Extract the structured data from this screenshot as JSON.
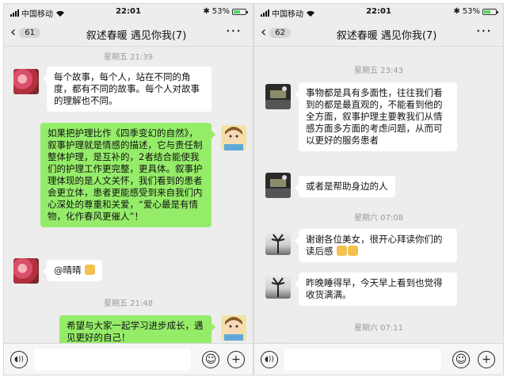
{
  "status": {
    "carrier": "中国移动",
    "time": "22:01",
    "battery": "53%",
    "battery_level": 0.53
  },
  "left": {
    "back_count": "61",
    "title": "叙述春暖 遇见你我(7)",
    "more": "···",
    "messages": [
      {
        "type": "time",
        "text": "星期五 21:39"
      },
      {
        "type": "in",
        "text": "每个故事，每个人，站在不同的角度，都有不同的故事。每个人对故事的理解也不同。"
      },
      {
        "type": "out",
        "text": "如果把护理比作《四季变幻的自然》，叙事护理就是情感的描述，它与责任制整体护理，是互补的，2者结合能使我们的护理工作更完整，更具体。叙事护理体现的是人文关怀，我们看到的患者会更立体，患者更能感受到来自我们内心深处的尊重和关爱，“爱心最是有情物，化作春风更催人”！"
      },
      {
        "type": "in",
        "text": "@晴晴"
      },
      {
        "type": "time",
        "text": "星期五 21:48"
      },
      {
        "type": "out",
        "text": "希望与大家一起学习进步成长，遇见更好的自己！"
      }
    ]
  },
  "right": {
    "back_count": "62",
    "title": "叙述春暖 遇见你我(7)",
    "more": "···",
    "messages": [
      {
        "type": "time",
        "text": "星期五 23:43"
      },
      {
        "type": "in",
        "text": "事物都是具有多面性，往往我们看到的都是最直观的，不能看到他的全方面，叙事护理主要教我们从情感方面多方面的考虑问题，从而可以更好的服务患者"
      },
      {
        "type": "in",
        "text": "或者是帮助身边的人"
      },
      {
        "type": "time",
        "text": "星期六 07:08"
      },
      {
        "type": "in",
        "text": "谢谢各位美女，很开心拜读你们的读后感"
      },
      {
        "type": "in",
        "text": "昨晚睡得早，今天早上看到也觉得收货满满。"
      },
      {
        "type": "time",
        "text": "星期六 07:11"
      }
    ]
  },
  "icons": {
    "back": "chevron-left-icon",
    "voice": "voice-icon",
    "emoji": "emoji-icon",
    "plus": "plus-icon",
    "thumbs": "thumbs-up-emoji"
  },
  "colors": {
    "out_bubble": "#95ec69",
    "in_bubble": "#ffffff",
    "background": "#ededed"
  }
}
